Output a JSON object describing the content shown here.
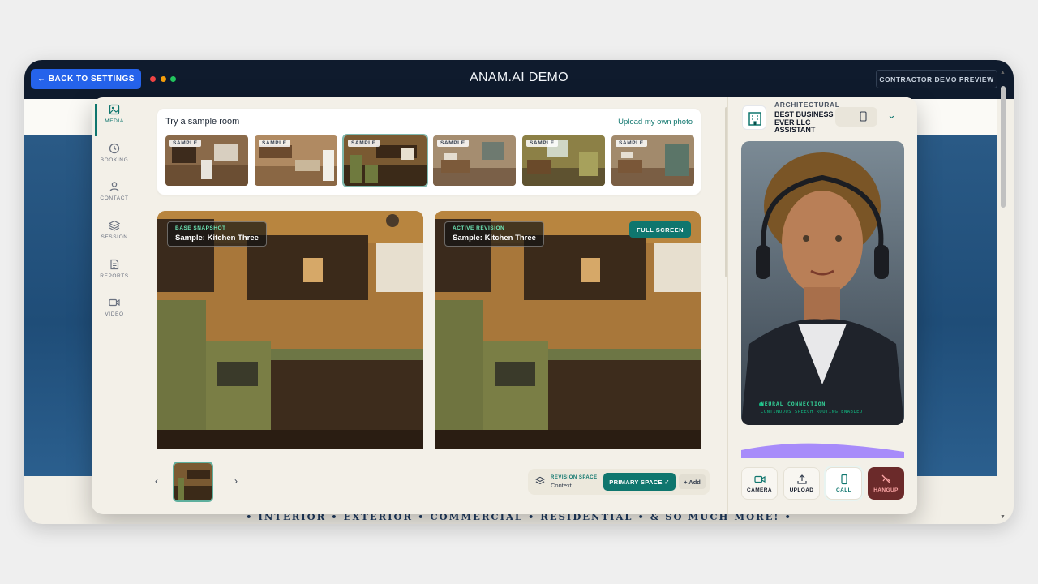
{
  "topbar": {
    "back_label": "← BACK TO SETTINGS",
    "title": "ANAM.AI DEMO",
    "preview_badge": "CONTRACTOR DEMO PREVIEW"
  },
  "rail": {
    "items": [
      {
        "label": "MEDIA",
        "icon": "image-icon",
        "active": true
      },
      {
        "label": "BOOKING",
        "icon": "clock-icon"
      },
      {
        "label": "CONTACT",
        "icon": "user-icon"
      },
      {
        "label": "SESSION",
        "icon": "layers-icon"
      },
      {
        "label": "REPORTS",
        "icon": "document-icon"
      },
      {
        "label": "VIDEO",
        "icon": "video-icon"
      }
    ]
  },
  "samples": {
    "title": "Try a sample room",
    "upload_label": "Upload my own photo",
    "tag": "SAMPLE",
    "count": 6,
    "selected_index": 2
  },
  "compare": {
    "left_small": "BASE SNAPSHOT",
    "left_big": "Sample: Kitchen Three",
    "right_small": "ACTIVE REVISION",
    "right_big": "Sample: Kitchen Three",
    "fullscreen_label": "FULL SCREEN"
  },
  "bottom": {
    "prev": "‹",
    "next": "›",
    "revision_small": "REVISION SPACE",
    "revision_big": "Context",
    "primary_label": "PRIMARY SPACE ✓",
    "add_label": "+ Add"
  },
  "assistant": {
    "overline": "ARCHITECTURAL",
    "name": "BEST BUSINESS EVER LLC ASSISTANT",
    "chevron": "⌄",
    "neural": "NEURAL CONNECTION",
    "neural_sub": "CONTINUOUS SPEECH ROUTING ENABLED",
    "controls": [
      {
        "label": "CAMERA",
        "icon": "camera-icon"
      },
      {
        "label": "UPLOAD",
        "icon": "upload-icon"
      },
      {
        "label": "CALL",
        "icon": "phone-icon"
      },
      {
        "label": "HANGUP",
        "icon": "hangup-icon"
      }
    ]
  },
  "tagline": "• INTERIOR • EXTERIOR • COMMERCIAL • RESIDENTIAL • & SO MUCH MORE! •",
  "colors": {
    "accent": "#0f766e",
    "topbar": "#0f1b2d",
    "back_button": "#2563eb",
    "hangup": "#6b2a2a"
  }
}
